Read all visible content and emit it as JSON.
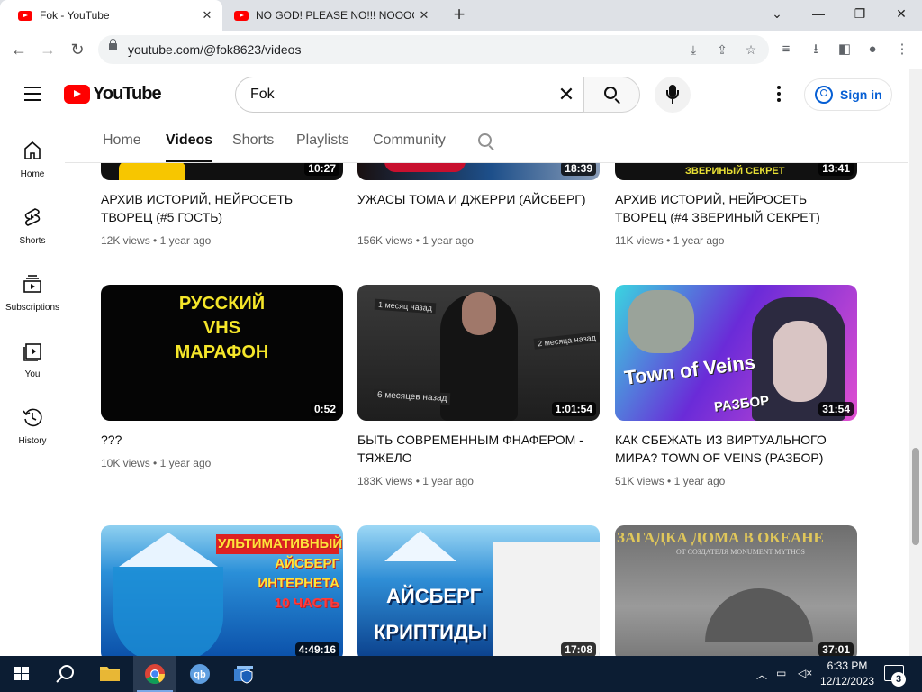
{
  "browser": {
    "tabs": [
      {
        "title": "Fok - YouTube",
        "active": true
      },
      {
        "title": "NO GOD! PLEASE NO!!! NOOOOO",
        "active": false
      }
    ],
    "new_tab": "+",
    "url": "youtube.com/@fok8623/videos",
    "window_controls": {
      "minimize": "—",
      "restore": "❐",
      "close": "✕",
      "tab_search": "⌄"
    }
  },
  "youtube": {
    "logo_text": "YouTube",
    "search_value": "Fok",
    "sign_in": "Sign in",
    "sidebar": [
      {
        "label": "Home",
        "icon": "home-icon"
      },
      {
        "label": "Shorts",
        "icon": "shorts-icon"
      },
      {
        "label": "Subscriptions",
        "icon": "subscriptions-icon"
      },
      {
        "label": "You",
        "icon": "you-icon"
      },
      {
        "label": "History",
        "icon": "history-icon"
      }
    ],
    "channel_tabs": [
      "Home",
      "Videos",
      "Shorts",
      "Playlists",
      "Community"
    ],
    "selected_tab": "Videos",
    "videos": [
      {
        "title": "АРХИВ ИСТОРИЙ, НЕЙРОСЕТЬ ТВОРЕЦ (#5 ГОСТЬ)",
        "views": "12K views",
        "age": "1 year ago",
        "duration": "10:27"
      },
      {
        "title": "УЖАСЫ ТОМА И ДЖЕРРИ (АЙСБЕРГ)",
        "views": "156K views",
        "age": "1 year ago",
        "duration": "18:39"
      },
      {
        "title": "АРХИВ ИСТОРИЙ, НЕЙРОСЕТЬ ТВОРЕЦ (#4 ЗВЕРИНЫЙ СЕКРЕТ)",
        "views": "11K views",
        "age": "1 year ago",
        "duration": "13:41"
      },
      {
        "title": "???",
        "views": "10K views",
        "age": "1 year ago",
        "duration": "0:52"
      },
      {
        "title": "БЫТЬ СОВРЕМЕННЫМ ФНАФЕРОМ - ТЯЖЕЛО",
        "views": "183K views",
        "age": "1 year ago",
        "duration": "1:01:54"
      },
      {
        "title": "КАК СБЕЖАТЬ ИЗ ВИРТУАЛЬНОГО МИРА? TOWN OF VEINS (РАЗБОР)",
        "views": "51K views",
        "age": "1 year ago",
        "duration": "31:54"
      },
      {
        "title": "",
        "views": "",
        "age": "",
        "duration": "4:49:16"
      },
      {
        "title": "",
        "views": "",
        "age": "",
        "duration": "17:08"
      },
      {
        "title": "",
        "views": "",
        "age": "",
        "duration": "37:01"
      }
    ],
    "thumb_text": {
      "t1_top": "ЗВЕРИНЫЙ СЕКРЕТ",
      "t3": [
        "РУССКИЙ",
        "VHS",
        "МАРАФОН"
      ],
      "t4_tags": [
        "1 месяц назад",
        "2 месяца назад",
        "6 месяцев назад"
      ],
      "t5": [
        "Town of Veins",
        "РАЗБОР"
      ],
      "t6": [
        "УЛЬТИМАТИВНЫЙ",
        "АЙСБЕРГ",
        "ИНТЕРНЕТА",
        "10 ЧАСТЬ"
      ],
      "t7": [
        "АЙСБЕРГ",
        "КРИПТИДЫ"
      ],
      "t8": [
        "ЗАГАДКА ДОМА В ОКЕАНЕ",
        "ОТ СОЗДАТЕЛЯ MONUMENT MYTHOS"
      ]
    }
  },
  "taskbar": {
    "time": "6:33 PM",
    "date": "12/12/2023",
    "notifications": "3"
  },
  "colors": {
    "youtube_red": "#ff0000",
    "link_blue": "#065fd4",
    "taskbar": "#0c1d33"
  }
}
